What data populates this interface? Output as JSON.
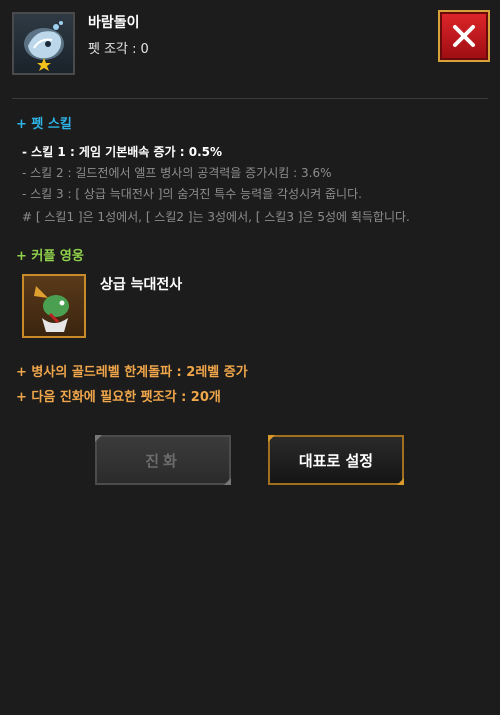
{
  "header": {
    "pet_name": "바람돌이",
    "shard_label": "펫 조각 :",
    "shard_count": "0",
    "close_icon": "close-icon"
  },
  "pet_skill": {
    "title": "+ 펫 스킬",
    "lines": [
      "- 스킬 1 : 게임 기본배속 증가 : 0.5%",
      "- 스킬 2 : 길드전에서 엘프 병사의 공격력을 증가시킴 : 3.6%",
      "- 스킬 3 : [ 상급 늑대전사 ]의 숨겨진 특수 능력을 각성시켜 줍니다.",
      "# [ 스킬1 ]은 1성에서, [ 스킬2 ]는 3성에서, [ 스킬3 ]은 5성에 획득합니다."
    ]
  },
  "couple_hero": {
    "title": "+ 커플 영웅",
    "name": "상급 늑대전사"
  },
  "bonuses": [
    "+ 병사의 골드레벨 한계돌파 : 2레벨 증가",
    "+ 다음 진화에 필요한 펫조각 : 20개"
  ],
  "buttons": {
    "evolve": "진화",
    "set_representative": "대표로 설정"
  },
  "colors": {
    "pet_skill_title": "#2fb3e6",
    "couple_title": "#8fd14a",
    "bonus": "#f0a64a",
    "close_button": "#d01c20"
  }
}
